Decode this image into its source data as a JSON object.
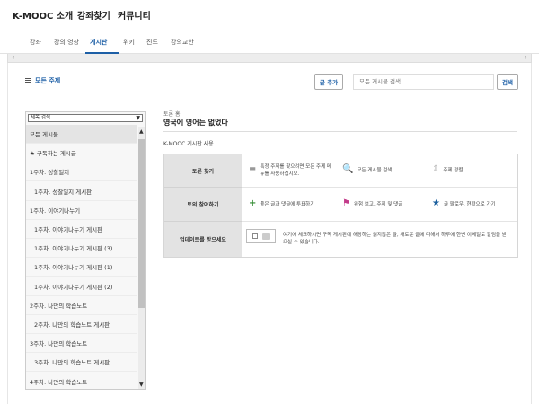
{
  "topnav": {
    "brand": "K-MOOC 소개",
    "find_course": "강좌찾기",
    "community": "커뮤니티"
  },
  "subnav": {
    "tabs": [
      "강좌",
      "강의 영상",
      "게시판",
      "위키",
      "진도",
      "강의교안"
    ],
    "active_tab": "게시판"
  },
  "toolbar": {
    "all_topics": "모든 주제",
    "new_post": "글 추가",
    "search_placeholder": "모든 게시물 검색",
    "search_button": "검색"
  },
  "sidebar": {
    "filter_placeholder": "제목 검색",
    "items": [
      {
        "label": "모든 게시물",
        "level": 0,
        "selected": true
      },
      {
        "label": "★ 구독하는 게시글",
        "level": 0
      },
      {
        "label": "1주차. 성찰일지",
        "level": 0
      },
      {
        "label": "1주차. 성찰일지 게시판",
        "level": 1
      },
      {
        "label": "1주차. 이야기나누기",
        "level": 0
      },
      {
        "label": "1주차. 이야기나누기 게시판",
        "level": 1
      },
      {
        "label": "1주차. 이야기나누기 게시판 (3)",
        "level": 1
      },
      {
        "label": "1주차. 이야기나누기 게시판 (1)",
        "level": 1
      },
      {
        "label": "1주차. 이야기나누기 게시판 (2)",
        "level": 1
      },
      {
        "label": "2주차. 나만의 학습노트",
        "level": 0
      },
      {
        "label": "2주차. 나만의 학습노트 게시판",
        "level": 1
      },
      {
        "label": "3주차. 나만의 학습노트",
        "level": 0
      },
      {
        "label": "3주차. 나만의 학습노트 게시판",
        "level": 1
      },
      {
        "label": "4주차. 나만의 학습노트",
        "level": 0
      }
    ]
  },
  "main": {
    "topic_sub": "토론 홈",
    "topic_title": "영국에 영어는 없었다",
    "usage_title": "K-MOOC 게시판 사용",
    "rows": [
      {
        "header": "토론 찾기",
        "cells": [
          {
            "icon": "≡",
            "text": "특정 주제를 찾으려면 모든 주제 메뉴를 사용하십시오."
          },
          {
            "icon": "🔍",
            "text": "모든 게시물 검색"
          },
          {
            "icon": "⇕",
            "text": "주제 정렬"
          }
        ]
      },
      {
        "header": "토의 참여하기",
        "cells": [
          {
            "icon": "+",
            "text": "좋은 글과 댓글에 투표하기"
          },
          {
            "icon": "⚑",
            "text": "위험 보고, 주제 및 댓글"
          },
          {
            "icon": "★",
            "text": "글 팔로우, 현황으로 가기"
          }
        ]
      },
      {
        "header": "업데이트를 받으세요",
        "cells": [
          {
            "icon": "",
            "text": "여기에 체크하시면 구독 게시판에 해당하는 읽지않은 글, 새로운 글에 대해서 하루에 한번 이메일로 알림을 받으실 수 있습니다."
          }
        ]
      }
    ]
  },
  "colors": {
    "accent": "#1d5fa6",
    "row_header_bg": "#e3e3e3",
    "sidebar_bg": "#f7f7f7"
  }
}
